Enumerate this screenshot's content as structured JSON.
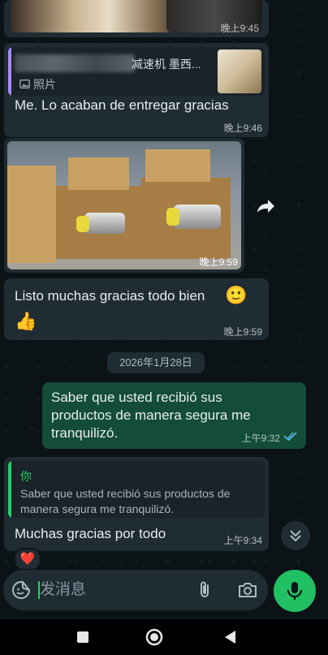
{
  "messages": {
    "image_top": {
      "time": "晚上9:45"
    },
    "reply_photo": {
      "quoted_sender": "减速机 墨西...",
      "quoted_type": "照片",
      "text": "Me. Lo acaban de entregar gracias",
      "time": "晚上9:46"
    },
    "boxes_photo": {
      "time": "晚上9:59"
    },
    "listo": {
      "text": "Listo muchas gracias todo bien",
      "emoji_smile": "🙂",
      "emoji_thumbs": "👍",
      "time": "晚上9:59"
    },
    "date_divider": "2026年1月28日",
    "saber": {
      "text": "Saber que usted recibió sus productos de manera segura me tranquilizó.",
      "time": "上午9:32",
      "status": "read"
    },
    "reply_you": {
      "quoted_sender": "你",
      "quoted_text": "Saber que usted recibió sus productos de manera segura me tranquilizó.",
      "text": "Muchas gracias  por todo",
      "time": "上午9:34",
      "reaction": "❤️"
    }
  },
  "composer": {
    "placeholder": "发消息"
  },
  "colors": {
    "incoming": "#1f2c33",
    "outgoing": "#134d37",
    "accent": "#25d366",
    "read_ticks": "#53bdeb"
  }
}
